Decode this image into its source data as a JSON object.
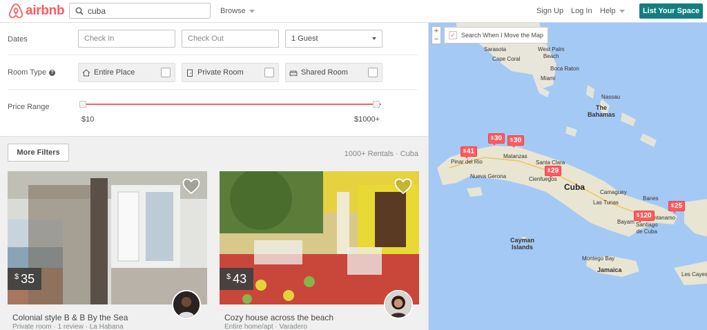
{
  "header": {
    "logo_text": "airbnb",
    "search_value": "cuba",
    "browse_label": "Browse",
    "signup_label": "Sign Up",
    "login_label": "Log In",
    "help_label": "Help",
    "list_space_label": "List Your Space",
    "brand_color": "#ff5a5f",
    "cta_color": "#127f7f"
  },
  "filters": {
    "dates_label": "Dates",
    "checkin_placeholder": "Check In",
    "checkout_placeholder": "Check Out",
    "guests_value": "1 Guest",
    "room_type_label": "Room Type",
    "room_types": [
      "Entire Place",
      "Private Room",
      "Shared Room"
    ],
    "price_range_label": "Price Range",
    "price_min": "$10",
    "price_max": "$1000+"
  },
  "results": {
    "more_filters_label": "More Filters",
    "count_text": "1000+ Rentals · Cuba",
    "listings": [
      {
        "currency": "$",
        "price": "35",
        "title": "Colonial style B & B By the Sea",
        "subtitle": "Private room · 1 review · La Habana"
      },
      {
        "currency": "$",
        "price": "43",
        "title": "Cozy house across the beach",
        "subtitle": "Entire home/apt · Varadero"
      }
    ]
  },
  "map": {
    "zoom_in": "+",
    "zoom_out": "−",
    "search_move_label": "Search When I Move the Map",
    "labels": {
      "sarasota": "Sarasota",
      "west_palm_beach": "West Palm\nBeach",
      "cape_coral": "Cape Coral",
      "boca_raton": "Boca Raton",
      "miami": "Miami",
      "nassau": "Nassau",
      "the_bahamas": "The\nBahamas",
      "matanzas": "Matanzas",
      "santa_clara": "Santa Clara",
      "pinar_del_rio": "Pinar del Rio",
      "cienfuegos": "Cienfuegos",
      "nueva_gerona": "Nueva Gerona",
      "cuba": "Cuba",
      "camaguey": "Camaguey",
      "las_tunas": "Las Tunas",
      "banes": "Banes",
      "bayamo": "Bayam",
      "guantanamo": "ntanamo",
      "santiago": "Santiago\nde Cuba",
      "cayman_islands": "Cayman\nIslands",
      "montego_bay": "Montego Bay",
      "jamaica": "Jamaica",
      "les_cayes": "Les Cayes"
    },
    "pins": [
      {
        "currency": "$",
        "price": "41"
      },
      {
        "currency": "$",
        "price": "30"
      },
      {
        "currency": "$",
        "price": "30"
      },
      {
        "currency": "$",
        "price": "29"
      },
      {
        "currency": "$",
        "price": "25"
      },
      {
        "currency": "$",
        "price": "120"
      }
    ]
  }
}
